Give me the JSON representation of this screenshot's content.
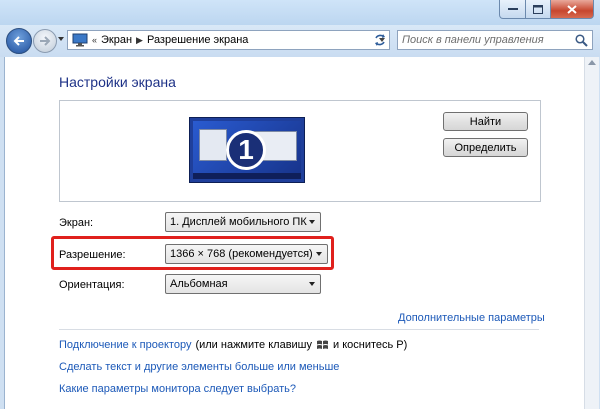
{
  "window": {
    "caption_buttons": [
      "minimize",
      "maximize",
      "close"
    ]
  },
  "navigation": {
    "breadcrumbs": [
      "Экран",
      "Разрешение экрана"
    ],
    "search_placeholder": "Поиск в панели управления"
  },
  "main": {
    "title": "Настройки экрана",
    "monitor_number": "1",
    "buttons": {
      "find": "Найти",
      "identify": "Определить"
    },
    "fields": {
      "screen": {
        "label": "Экран:",
        "value": "1. Дисплей мобильного ПК"
      },
      "resolution": {
        "label": "Разрешение:",
        "value": "1366 × 768 (рекомендуется)"
      },
      "orientation": {
        "label": "Ориентация:",
        "value": "Альбомная"
      }
    },
    "advanced_link": "Дополнительные параметры",
    "projector": {
      "link": "Подключение к проектору",
      "text_before": "(или нажмите клавишу",
      "text_after": "и коснитесь P)"
    },
    "bigger_text_link": "Сделать текст и другие элементы больше или меньше",
    "which_monitor_link": "Какие параметры монитора следует выбрать?"
  },
  "colors": {
    "title": "#1e3287",
    "link": "#1c59b8",
    "highlight": "#e0201c"
  }
}
